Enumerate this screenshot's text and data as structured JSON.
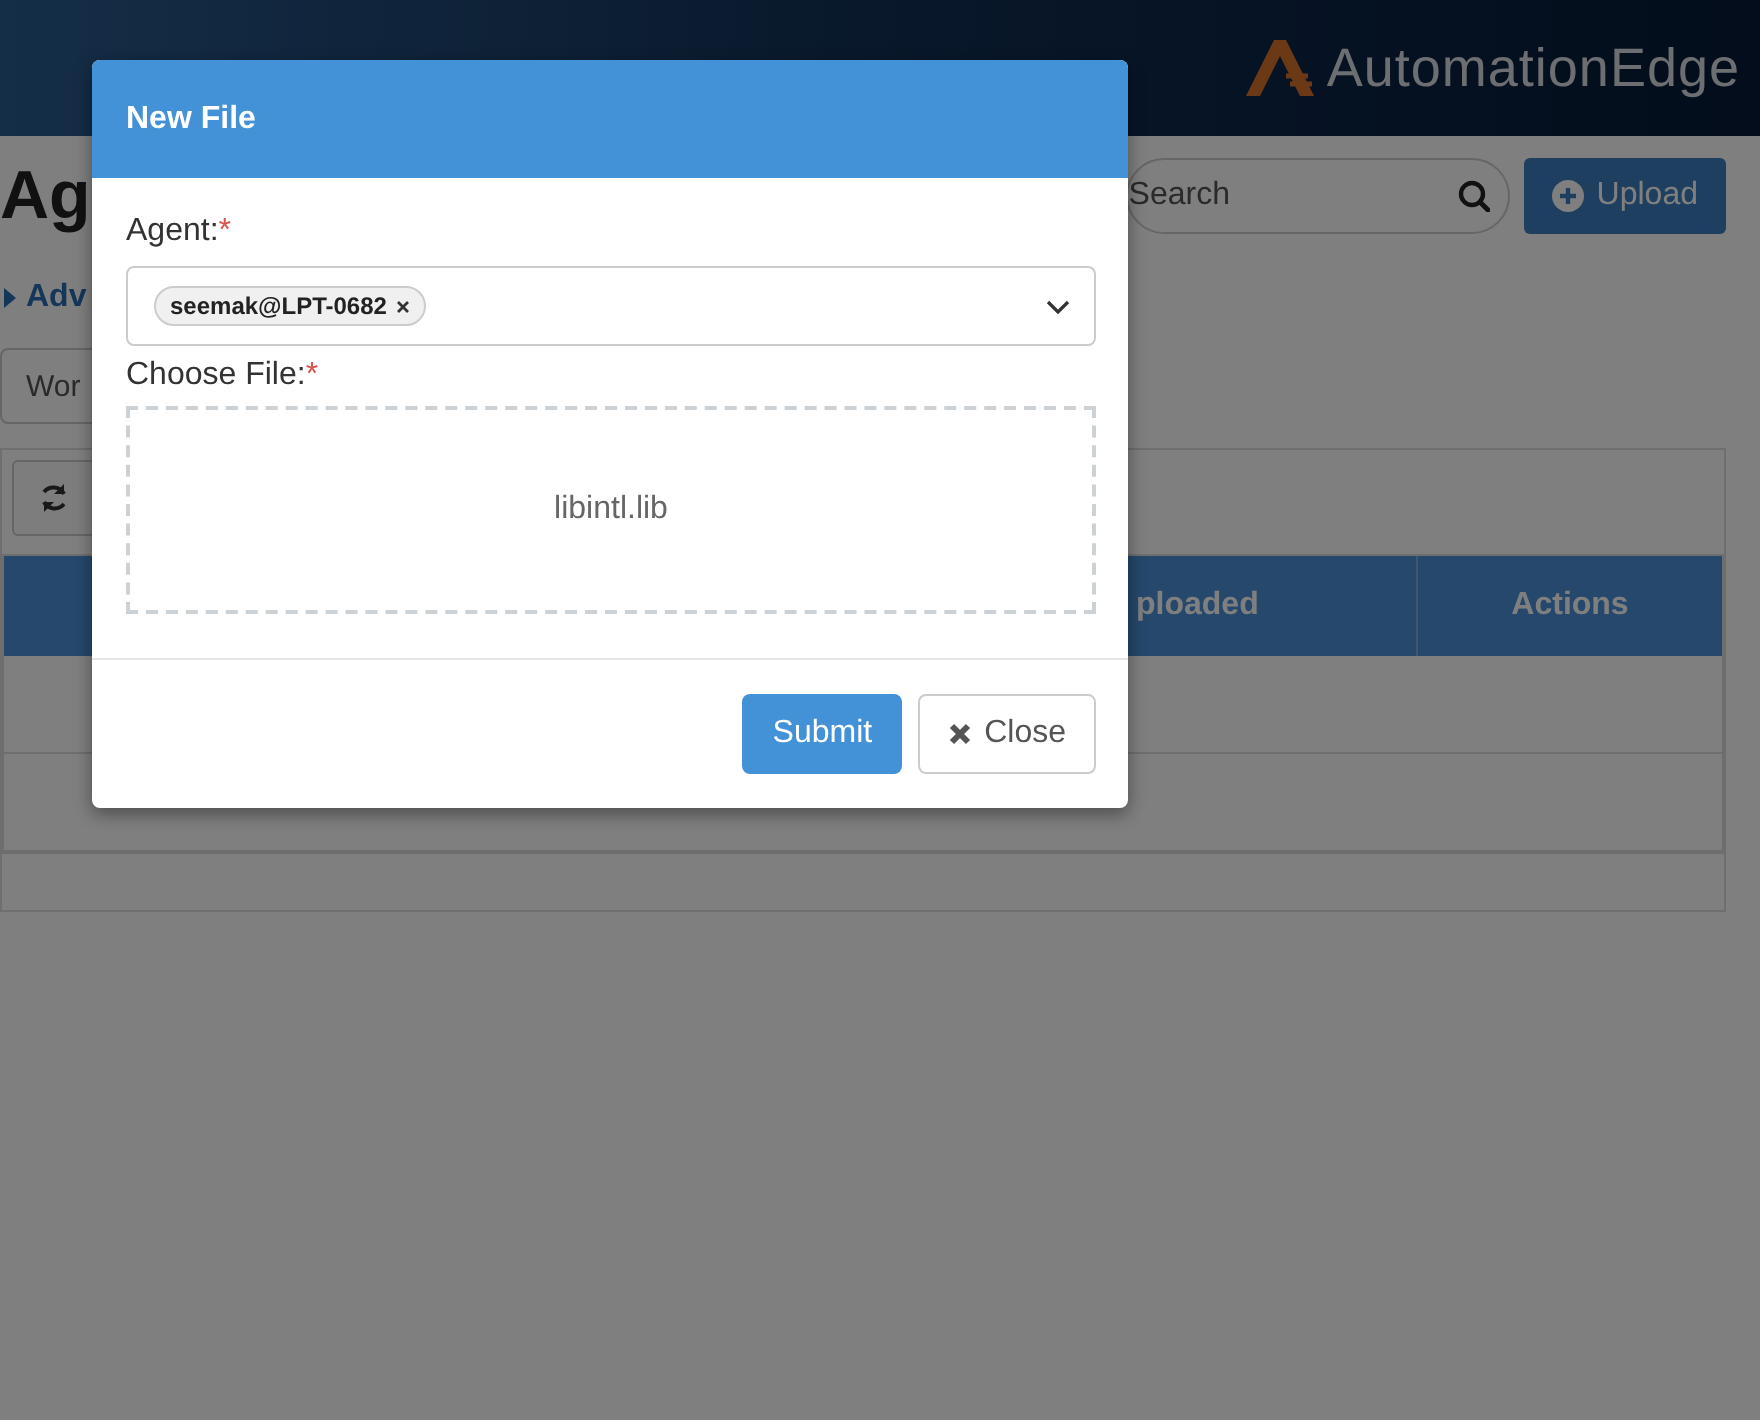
{
  "header": {
    "logo_text": "AutomationEdge"
  },
  "page": {
    "title": "Ag",
    "advanced_link": "Adv",
    "filter_select": "Wor",
    "search": {
      "placeholder": "Search"
    },
    "upload_button": "Upload",
    "table": {
      "columns": [
        "ploaded",
        "Actions"
      ]
    }
  },
  "modal": {
    "title": "New File",
    "fields": [
      {
        "kind": "tags",
        "label": "Agent:",
        "required_mark": "*",
        "tags": [
          "seemak@LPT-0682"
        ]
      },
      {
        "kind": "file",
        "label": "Choose File:",
        "required_mark": "*",
        "file_name": "libintl.lib"
      }
    ],
    "buttons": [
      {
        "kind": "primary",
        "label": "Submit"
      },
      {
        "kind": "close",
        "label": "Close"
      }
    ]
  }
}
